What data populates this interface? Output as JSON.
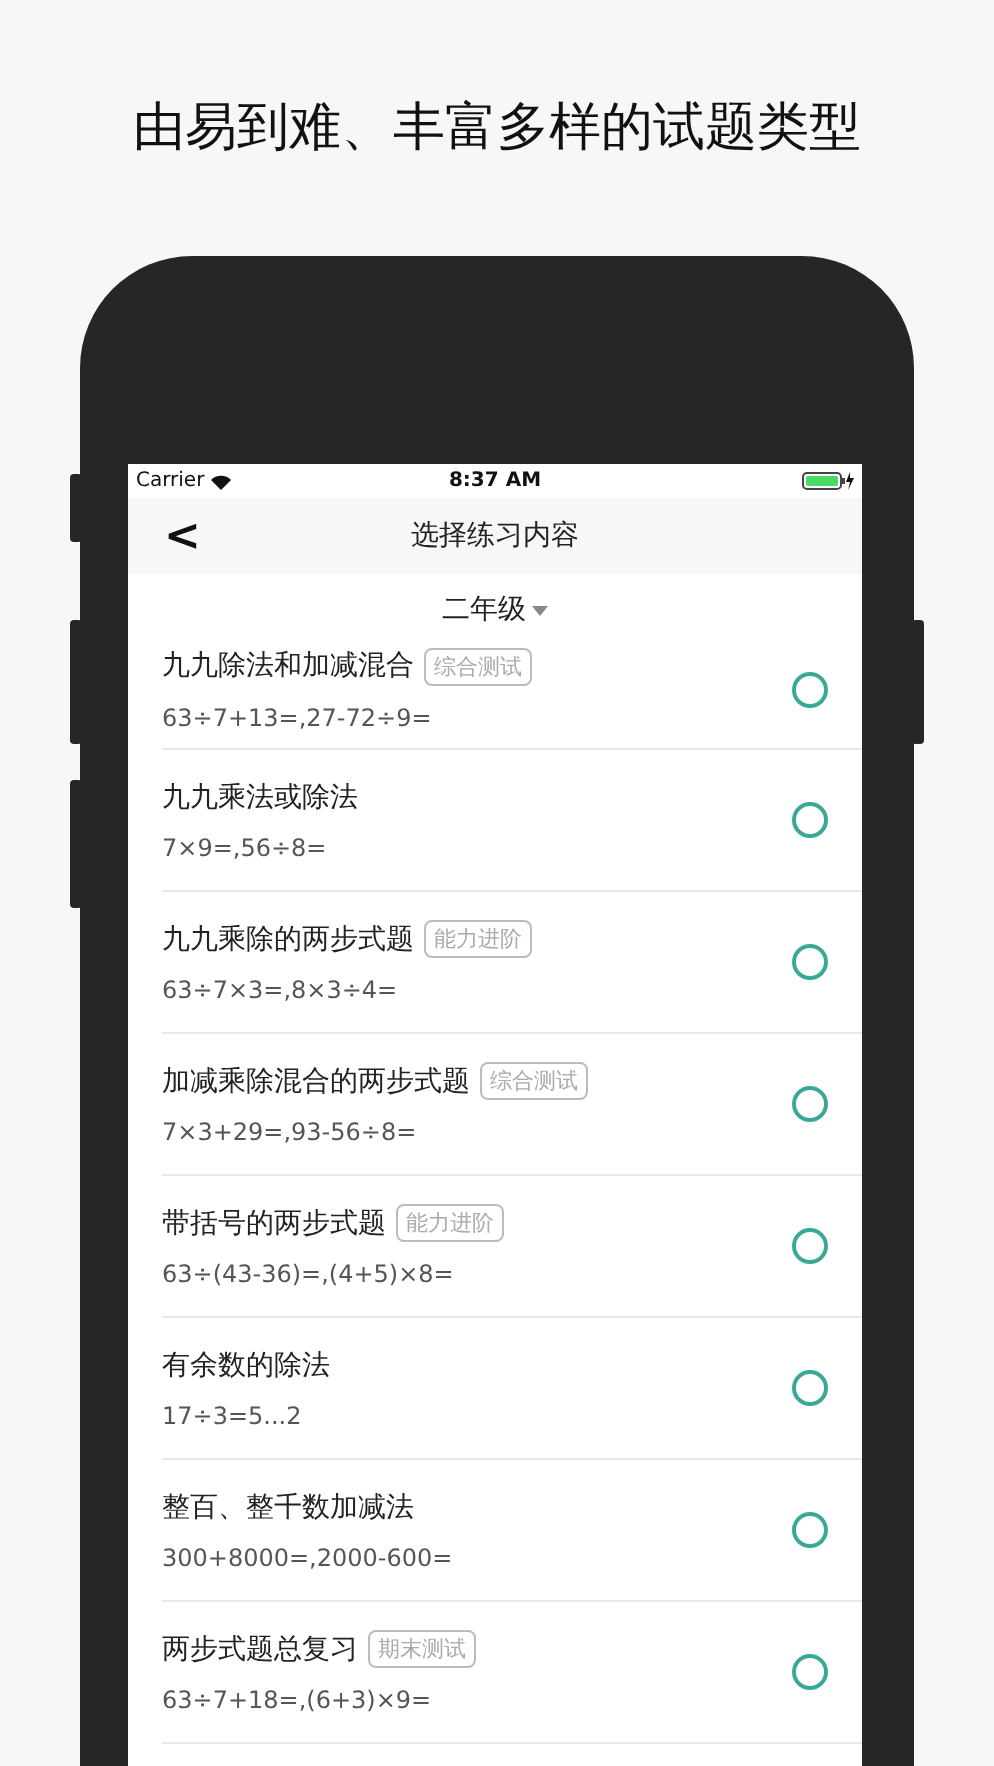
{
  "headline": "由易到难、丰富多样的试题类型",
  "status_bar": {
    "carrier": "Carrier",
    "time": "8:37 AM"
  },
  "nav": {
    "back": "<",
    "title": "选择练习内容"
  },
  "grade": "二年级",
  "exercises": [
    {
      "title": "九九除法和加减混合",
      "tag": "综合测试",
      "example": "63÷7+13=,27-72÷9=",
      "selected": false
    },
    {
      "title": "九九乘法或除法",
      "example": "7×9=,56÷8=",
      "selected": false
    },
    {
      "title": "九九乘除的两步式题",
      "tag": "能力进阶",
      "example": "63÷7×3=,8×3÷4=",
      "selected": false
    },
    {
      "title": "加减乘除混合的两步式题",
      "tag": "综合测试",
      "example": "7×3+29=,93-56÷8=",
      "selected": false
    },
    {
      "title": "带括号的两步式题",
      "tag": "能力进阶",
      "example": "63÷(43-36)=,(4+5)×8=",
      "selected": false
    },
    {
      "title": "有余数的除法",
      "example": "17÷3=5...2",
      "selected": false
    },
    {
      "title": "整百、整千数加减法",
      "example": "300+8000=,2000-600=",
      "selected": false
    },
    {
      "title": "两步式题总复习",
      "tag": "期末测试",
      "example": "63÷7+18=,(6+3)×9=",
      "selected": false
    }
  ]
}
